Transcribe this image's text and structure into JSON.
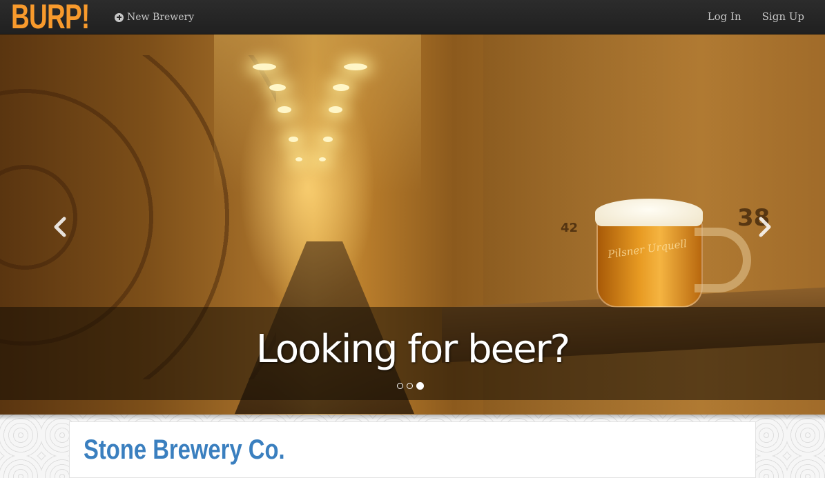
{
  "navbar": {
    "brand": "BURP!",
    "new_brewery_label": "New Brewery",
    "login_label": "Log In",
    "signup_label": "Sign Up",
    "brand_color": "#f89a2c"
  },
  "carousel": {
    "caption": "Looking for beer?",
    "indicators_total": 3,
    "active_indicator": 3,
    "prev_icon": "chevron-left-icon",
    "next_icon": "chevron-right-icon",
    "image_text": {
      "mug_logo": "Pilsner Urquell",
      "barrel_number_left": "42",
      "barrel_number_right": "38"
    }
  },
  "content": {
    "brewery_name": "Stone Brewery Co.",
    "title_color": "#3a7fbf"
  }
}
